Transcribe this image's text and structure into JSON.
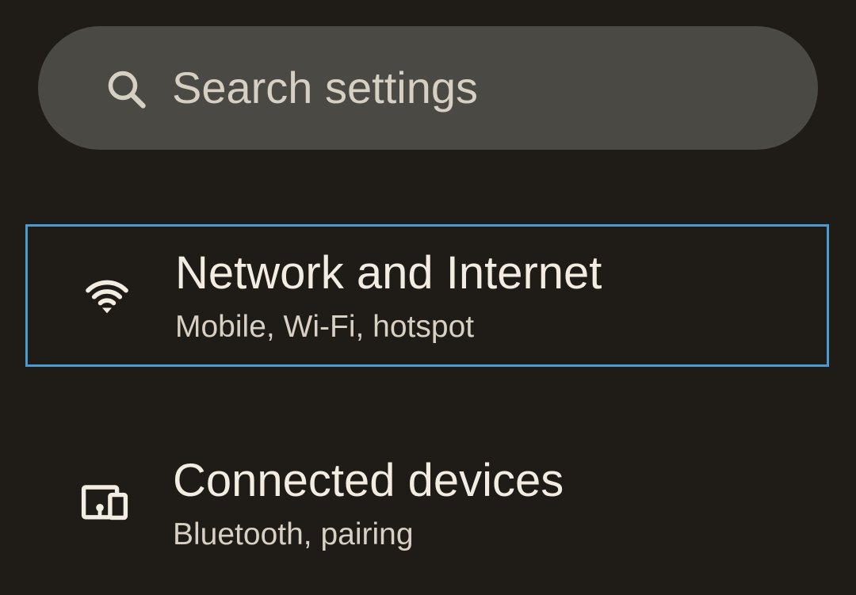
{
  "search": {
    "placeholder": "Search settings",
    "icon": "search-icon"
  },
  "settings_items": [
    {
      "title": "Network and Internet",
      "subtitle": "Mobile, Wi-Fi, hotspot",
      "icon": "wifi-icon",
      "focused": true
    },
    {
      "title": "Connected devices",
      "subtitle": "Bluetooth, pairing",
      "icon": "connected-devices-icon",
      "focused": false
    }
  ],
  "colors": {
    "background": "#1f1b17",
    "search_bar": "#4b4943",
    "focus_outline": "#4b9ad1",
    "text_primary": "#f3ece2",
    "text_secondary": "#d8d0c4"
  }
}
